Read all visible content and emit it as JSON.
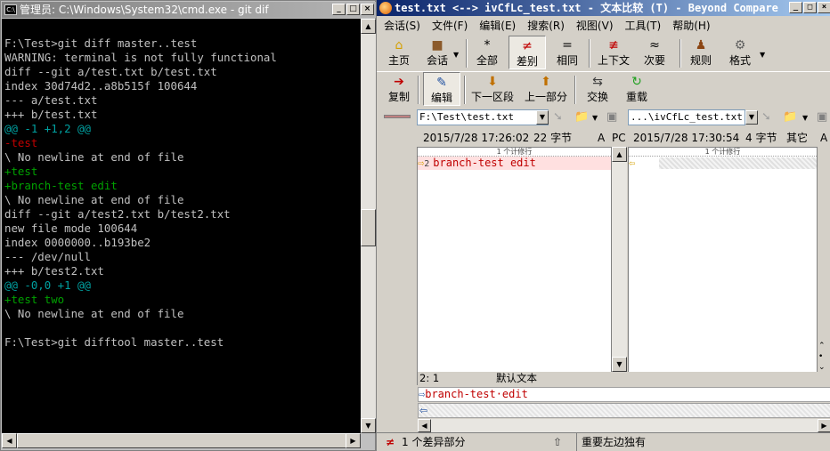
{
  "cmd": {
    "title": "管理员: C:\\Windows\\System32\\cmd.exe - git  dif",
    "icon_text": "C:\\",
    "lines": [
      {
        "text": "",
        "color": "default"
      },
      {
        "text": "F:\\Test>git diff master..test",
        "color": "default"
      },
      {
        "text": "WARNING: terminal is not fully functional",
        "color": "default"
      },
      {
        "text": "diff --git a/test.txt b/test.txt",
        "color": "default"
      },
      {
        "text": "index 30d74d2..a8b515f 100644",
        "color": "default"
      },
      {
        "text": "--- a/test.txt",
        "color": "default"
      },
      {
        "text": "+++ b/test.txt",
        "color": "default"
      },
      {
        "text": "@@ -1 +1,2 @@",
        "color": "cyan"
      },
      {
        "text": "-test",
        "color": "red"
      },
      {
        "text": "\\ No newline at end of file",
        "color": "default"
      },
      {
        "text": "+test",
        "color": "green"
      },
      {
        "text": "+branch-test edit",
        "color": "green"
      },
      {
        "text": "\\ No newline at end of file",
        "color": "default"
      },
      {
        "text": "diff --git a/test2.txt b/test2.txt",
        "color": "default"
      },
      {
        "text": "new file mode 100644",
        "color": "default"
      },
      {
        "text": "index 0000000..b193be2",
        "color": "default"
      },
      {
        "text": "--- /dev/null",
        "color": "default"
      },
      {
        "text": "+++ b/test2.txt",
        "color": "default"
      },
      {
        "text": "@@ -0,0 +1 @@",
        "color": "cyan"
      },
      {
        "text": "+test two",
        "color": "green"
      },
      {
        "text": "\\ No newline at end of file",
        "color": "default"
      },
      {
        "text": "",
        "color": "default"
      },
      {
        "text": "F:\\Test>git difftool master..test",
        "color": "default"
      }
    ],
    "colors": {
      "default": "#c0c0c0",
      "red": "#c00000",
      "green": "#00a000",
      "cyan": "#00a0a0"
    }
  },
  "bc": {
    "title": "test.txt <--> ivCfLc_test.txt - 文本比较 (T) - Beyond Compare",
    "menu": [
      "会话(S)",
      "文件(F)",
      "编辑(E)",
      "搜索(R)",
      "视图(V)",
      "工具(T)",
      "帮助(H)"
    ],
    "toolbar1": {
      "home": "主页",
      "session": "会话",
      "all": "全部",
      "diffs": "差别",
      "same": "相同",
      "context": "上下文",
      "minor": "次要",
      "rules": "规则",
      "format": "格式"
    },
    "toolbar2": {
      "copy": "复制",
      "edit": "编辑",
      "next_section": "下一区段",
      "prev_section": "上一部分",
      "swap": "交换",
      "reload": "重载"
    },
    "left_path": "F:\\Test\\test.txt",
    "right_path": "...\\ivCfLc_test.txt",
    "left_info": {
      "date": "2015/7/28 17:26:02",
      "size": "22 字节",
      "enc": "A",
      "eol": "PC"
    },
    "right_info": {
      "date": "2015/7/28 17:30:54",
      "size": "4 字节",
      "eol": "其它",
      "enc": "A"
    },
    "pane_header": "1 个计修行",
    "left_line_no": "2",
    "left_line": "branch-test edit",
    "left_status_pos": "2: 1",
    "left_status_enc": "默认文本",
    "detail_text": "branch-test·edit",
    "status_count": "1 个差异部分",
    "status_message": "重要左边独有",
    "accent_color": "#c00000",
    "diff_bg": "#ffe0e0"
  }
}
